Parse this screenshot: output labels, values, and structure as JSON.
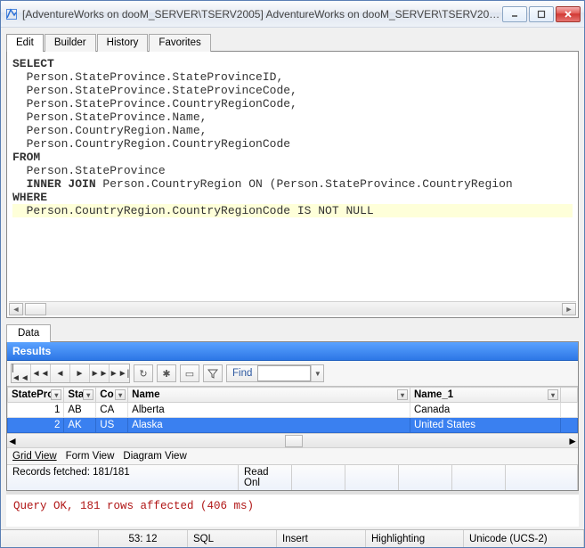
{
  "window": {
    "title": "[AdventureWorks on dooM_SERVER\\TSERV2005] AdventureWorks on dooM_SERVER\\TSERV2005 5"
  },
  "tabs": {
    "items": [
      "Edit",
      "Builder",
      "History",
      "Favorites"
    ],
    "active": 0
  },
  "sql": {
    "lines": [
      {
        "indent": 0,
        "kw": "SELECT",
        "rest": ""
      },
      {
        "indent": 1,
        "kw": "",
        "rest": "Person.StateProvince.StateProvinceID,"
      },
      {
        "indent": 1,
        "kw": "",
        "rest": "Person.StateProvince.StateProvinceCode,"
      },
      {
        "indent": 1,
        "kw": "",
        "rest": "Person.StateProvince.CountryRegionCode,"
      },
      {
        "indent": 1,
        "kw": "",
        "rest": "Person.StateProvince.Name,"
      },
      {
        "indent": 1,
        "kw": "",
        "rest": "Person.CountryRegion.Name,"
      },
      {
        "indent": 1,
        "kw": "",
        "rest": "Person.CountryRegion.CountryRegionCode"
      },
      {
        "indent": 0,
        "kw": "FROM",
        "rest": ""
      },
      {
        "indent": 1,
        "kw": "",
        "rest": "Person.StateProvince"
      },
      {
        "indent": 1,
        "kw": "INNER JOIN",
        "rest": " Person.CountryRegion ON (Person.StateProvince.CountryRegion"
      },
      {
        "indent": 0,
        "kw": "WHERE",
        "rest": ""
      },
      {
        "indent": 1,
        "kw": "",
        "rest": "Person.CountryRegion.CountryRegionCode IS NOT NULL",
        "hl": true
      }
    ]
  },
  "data_tab_label": "Data",
  "results": {
    "title": "Results",
    "find_label": "Find",
    "find_value": "",
    "columns": [
      "StatePro",
      "Sta",
      "Co",
      "Name",
      "Name_1"
    ],
    "rows": [
      {
        "n": "1",
        "c1": "AB",
        "c2": "CA",
        "c3": "Alberta",
        "c4": "Canada",
        "sel": false
      },
      {
        "n": "2",
        "c1": "AK",
        "c2": "US",
        "c3": "Alaska",
        "c4": "United States",
        "sel": true
      }
    ],
    "views": [
      "Grid View",
      "Form View",
      "Diagram View"
    ],
    "active_view": 0,
    "status": {
      "fetched": "Records fetched: 181/181",
      "readonly": "Read Onl"
    }
  },
  "message": "Query OK, 181 rows affected (406 ms)",
  "statusbar": {
    "pos": "53: 12",
    "lang": "SQL",
    "mode": "Insert",
    "hl": "Highlighting",
    "enc": "Unicode (UCS-2)"
  }
}
